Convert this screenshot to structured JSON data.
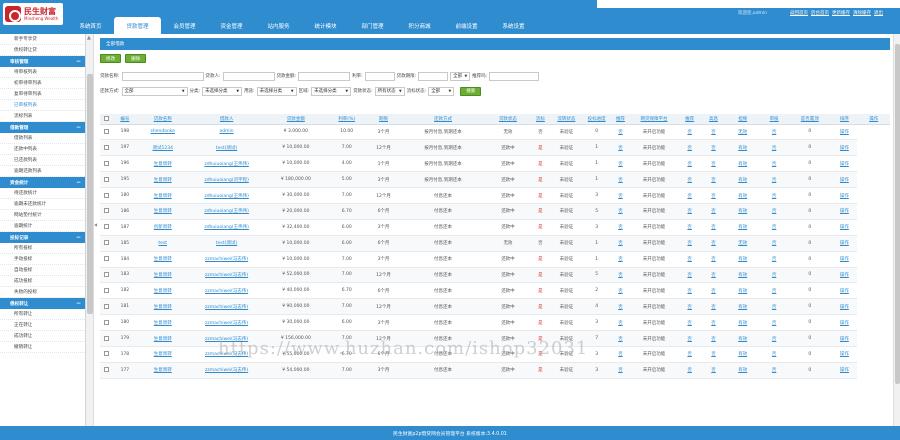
{
  "brand": {
    "name": "民生财富",
    "sub": "Minsheng Wealth"
  },
  "nav": [
    "系统首页",
    "贷款管理",
    "会员管理",
    "资金管理",
    "站内服务",
    "统计模块",
    "部门管理",
    "积分商城",
    "前端设置",
    "系统设置"
  ],
  "nav_active_index": 1,
  "header": {
    "welcome": "欢迎您,admin",
    "links": [
      "返回首页",
      "后台首页",
      "更新缓存",
      "清除缓存",
      "退出"
    ]
  },
  "sidebar": {
    "top_items": [
      "新手专享贷",
      "债权转让贷"
    ],
    "groups": [
      {
        "title": "审核管理",
        "items": [
          "待审核列表",
          "初审待审列表",
          "复审待审列表",
          "已审核列表",
          "流标列表"
        ]
      },
      {
        "title": "借款管理",
        "items": [
          "借款列表",
          "还款中列表",
          "已还款列表",
          "逾期还款列表"
        ]
      },
      {
        "title": "资金统计",
        "items": [
          "待还款统计",
          "逾期未还款统计",
          "网站垫付统计",
          "逾期统计"
        ]
      },
      {
        "title": "投标记录",
        "items": [
          "所有投标",
          "手动投标",
          "自动投标",
          "成功投标",
          "失败的投标"
        ]
      },
      {
        "title": "债权转让",
        "items": [
          "所有转让",
          "正在转让",
          "成功转让",
          "撤销转让"
        ]
      }
    ],
    "current": "已审核列表"
  },
  "panel_title": "全部借款",
  "toolbar": {
    "edit": "修改",
    "delete": "删除"
  },
  "filters": {
    "row1": [
      {
        "label": "贷款名称:",
        "value": ""
      },
      {
        "label": "贷款人:",
        "value": ""
      },
      {
        "label": "贷款金额:",
        "value": ""
      },
      {
        "label": "利率:",
        "value": ""
      },
      {
        "label": "贷款期限:",
        "value": ""
      },
      {
        "label": "",
        "value": "全部",
        "select": true
      },
      {
        "label": "推荐吗:",
        "value": ""
      }
    ],
    "row2": [
      {
        "label": "还款方式:",
        "value": "全部"
      },
      {
        "label": "分类:",
        "value": "未选择分类"
      },
      {
        "label": "用途:",
        "value": "未选择分类"
      },
      {
        "label": "区域:",
        "value": "未选择分类"
      },
      {
        "label": "贷款状态:",
        "value": "所有状态"
      },
      {
        "label": "流标状态:",
        "value": "全部"
      }
    ],
    "search": "搜索"
  },
  "columns": [
    "编号",
    "贷款名称",
    "借款人",
    "贷款金额",
    "利率(%)",
    "期限",
    "还款方式",
    "贷款状态",
    "流标",
    "流转状态",
    "投标进度",
    "推荐",
    "网贷保障平台",
    "推荐",
    "高息",
    "担保",
    "审核",
    "是否置顶",
    "排序",
    "操作"
  ],
  "rows": [
    {
      "id": "198",
      "name": "shendanke",
      "user": "admin",
      "amount": "¥ 3,000.00",
      "rate": "10.00",
      "term": "3个月",
      "method": "按月付息,到期还本",
      "status": "无效",
      "flow": "否",
      "flowst": "未验证",
      "progress": "0",
      "rec": "否",
      "plat": "未开启功能",
      "rec2": "否",
      "hi": "否",
      "guar": "无效",
      "audit": "否",
      "top": "0",
      "op": "操作"
    },
    {
      "id": "197",
      "name": "测试1234",
      "user": "test(测试)",
      "amount": "¥ 10,000.00",
      "rate": "7.00",
      "term": "12个月",
      "method": "按月付息,到期还本",
      "status": "还款中",
      "flow": "是",
      "flowst": "未验证",
      "progress": "1",
      "rec": "否",
      "plat": "未开启功能",
      "rec2": "否",
      "hi": "否",
      "guar": "有效",
      "audit": "否",
      "top": "0",
      "op": "操作"
    },
    {
      "id": "196",
      "name": "生意周转",
      "user": "zdhuiuoiang(王伟伟)",
      "amount": "¥ 10,000.00",
      "rate": "4.00",
      "term": "1个月",
      "method": "按月付息,到期还本",
      "status": "还款中",
      "flow": "是",
      "flowst": "未验证",
      "progress": "1",
      "rec": "否",
      "plat": "未开启功能",
      "rec2": "否",
      "hi": "否",
      "guar": "有效",
      "audit": "否",
      "top": "0",
      "op": "操作"
    },
    {
      "id": "195",
      "name": "生意周转",
      "user": "zdhuiuoiang(刘宇程)",
      "amount": "¥ 180,000.00",
      "rate": "5.00",
      "term": "3个月",
      "method": "按月付息,到期还本",
      "status": "还款中",
      "flow": "是",
      "flowst": "未验证",
      "progress": "1",
      "rec": "否",
      "plat": "未开启功能",
      "rec2": "否",
      "hi": "否",
      "guar": "有效",
      "audit": "否",
      "top": "0",
      "op": "操作"
    },
    {
      "id": "180",
      "name": "生意周转",
      "user": "zdhuiuoiang(王伟伟)",
      "amount": "¥ 30,000.00",
      "rate": "7.00",
      "term": "12个月",
      "method": "付息还本",
      "status": "还款中",
      "flow": "是",
      "flowst": "未验证",
      "progress": "3",
      "rec": "否",
      "plat": "未开启功能",
      "rec2": "否",
      "hi": "否",
      "guar": "有效",
      "audit": "否",
      "top": "0",
      "op": "操作"
    },
    {
      "id": "186",
      "name": "生意周转",
      "user": "zdhuiuoiang(王伟伟)",
      "amount": "¥ 20,000.00",
      "rate": "6.70",
      "term": "6个月",
      "method": "付息还本",
      "status": "还款中",
      "flow": "是",
      "flowst": "未验证",
      "progress": "5",
      "rec": "否",
      "plat": "未开启功能",
      "rec2": "否",
      "hi": "否",
      "guar": "有效",
      "audit": "否",
      "top": "0",
      "op": "操作"
    },
    {
      "id": "187",
      "name": "创新周转",
      "user": "zdhuiuoiang(王伟伟)",
      "amount": "¥ 32,400.00",
      "rate": "6.00",
      "term": "3个月",
      "method": "付息还本",
      "status": "还款中",
      "flow": "是",
      "flowst": "未验证",
      "progress": "3",
      "rec": "否",
      "plat": "未开启功能",
      "rec2": "否",
      "hi": "否",
      "guar": "有效",
      "audit": "否",
      "top": "0",
      "op": "操作"
    },
    {
      "id": "185",
      "name": "test",
      "user": "test(测试)",
      "amount": "¥ 10,000.00",
      "rate": "6.00",
      "term": "6个月",
      "method": "付息还本",
      "status": "无效",
      "flow": "否",
      "flowst": "未验证",
      "progress": "1",
      "rec": "否",
      "plat": "未开启功能",
      "rec2": "否",
      "hi": "否",
      "guar": "无效",
      "audit": "否",
      "top": "0",
      "op": "操作"
    },
    {
      "id": "184",
      "name": "生意周转",
      "user": "zzmachiwei(马志伟)",
      "amount": "¥ 10,000.00",
      "rate": "7.00",
      "term": "3个月",
      "method": "付息还本",
      "status": "还款中",
      "flow": "是",
      "flowst": "未验证",
      "progress": "1",
      "rec": "否",
      "plat": "未开启功能",
      "rec2": "否",
      "hi": "否",
      "guar": "有效",
      "audit": "否",
      "top": "0",
      "op": "操作"
    },
    {
      "id": "183",
      "name": "生意周转",
      "user": "zzmachiwei(马志伟)",
      "amount": "¥ 52,000.00",
      "rate": "7.00",
      "term": "12个月",
      "method": "付息还本",
      "status": "还款中",
      "flow": "是",
      "flowst": "未验证",
      "progress": "5",
      "rec": "否",
      "plat": "未开启功能",
      "rec2": "否",
      "hi": "否",
      "guar": "有效",
      "audit": "否",
      "top": "0",
      "op": "操作"
    },
    {
      "id": "182",
      "name": "生意周转",
      "user": "zzmachiwei(马志伟)",
      "amount": "¥ 40,000.00",
      "rate": "6.70",
      "term": "6个月",
      "method": "付息还本",
      "status": "还款中",
      "flow": "是",
      "flowst": "未验证",
      "progress": "2",
      "rec": "否",
      "plat": "未开启功能",
      "rec2": "否",
      "hi": "否",
      "guar": "有效",
      "audit": "否",
      "top": "0",
      "op": "操作"
    },
    {
      "id": "181",
      "name": "生意周转",
      "user": "zzmachiwei(马志伟)",
      "amount": "¥ 90,000.00",
      "rate": "7.00",
      "term": "12个月",
      "method": "付息还本",
      "status": "还款中",
      "flow": "是",
      "flowst": "未验证",
      "progress": "4",
      "rec": "否",
      "plat": "未开启功能",
      "rec2": "否",
      "hi": "否",
      "guar": "有效",
      "audit": "否",
      "top": "0",
      "op": "操作"
    },
    {
      "id": "180",
      "name": "生意周转",
      "user": "zzmachiwei(马志伟)",
      "amount": "¥ 30,000.00",
      "rate": "6.00",
      "term": "3个月",
      "method": "付息还本",
      "status": "还款中",
      "flow": "是",
      "flowst": "未验证",
      "progress": "3",
      "rec": "否",
      "plat": "未开启功能",
      "rec2": "否",
      "hi": "否",
      "guar": "有效",
      "audit": "否",
      "top": "0",
      "op": "操作"
    },
    {
      "id": "179",
      "name": "生意周转",
      "user": "zzmachiwei(马志伟)",
      "amount": "¥ 156,000.00",
      "rate": "7.00",
      "term": "12个月",
      "method": "付息还本",
      "status": "还款中",
      "flow": "是",
      "flowst": "未验证",
      "progress": "7",
      "rec": "否",
      "plat": "未开启功能",
      "rec2": "否",
      "hi": "否",
      "guar": "有效",
      "audit": "否",
      "top": "0",
      "op": "操作"
    },
    {
      "id": "178",
      "name": "生意周转",
      "user": "zzmachiwei(马志伟)",
      "amount": "¥ 55,000.00",
      "rate": "6.70",
      "term": "6个月",
      "method": "付息还本",
      "status": "还款中",
      "flow": "是",
      "flowst": "未验证",
      "progress": "3",
      "rec": "否",
      "plat": "未开启功能",
      "rec2": "否",
      "hi": "否",
      "guar": "有效",
      "audit": "否",
      "top": "0",
      "op": "操作"
    },
    {
      "id": "177",
      "name": "生意周转",
      "user": "zzmachiwei(马志伟)",
      "amount": "¥ 54,000.00",
      "rate": "7.00",
      "term": "3个月",
      "method": "付息还本",
      "status": "还款中",
      "flow": "是",
      "flowst": "未验证",
      "progress": "3",
      "rec": "否",
      "plat": "未开启功能",
      "rec2": "否",
      "hi": "否",
      "guar": "有效",
      "audit": "否",
      "top": "0",
      "op": "操作"
    }
  ],
  "footer": "民生财富p2p借贷网会员管理平台 系统版本:3.4.0.01",
  "watermark": "https://www.huzhan.com/ishop32031",
  "colors": {
    "primary": "#2e8ccf",
    "button": "#6cae34",
    "flag": "#e03030"
  }
}
